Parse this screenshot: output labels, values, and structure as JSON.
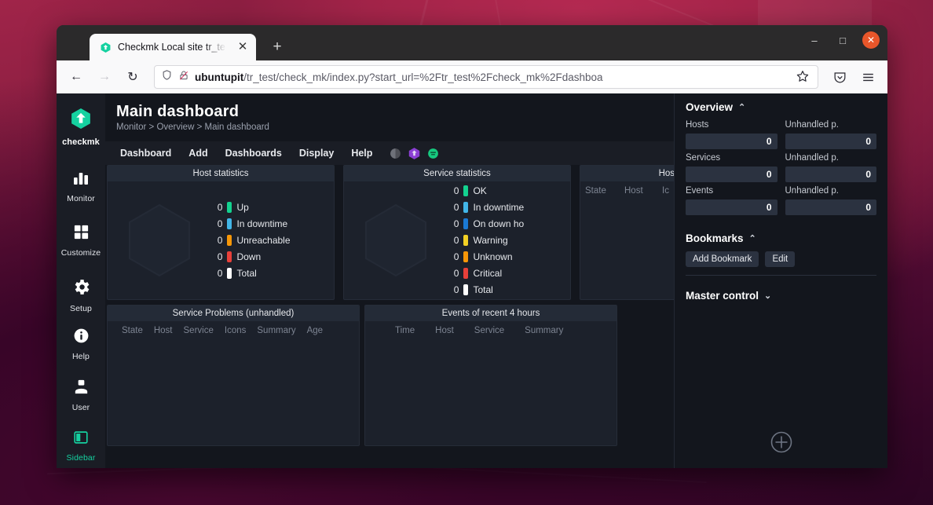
{
  "browser": {
    "tab": {
      "title": "Checkmk Local site tr_te",
      "favicon": "checkmk-hexagon-icon",
      "close": "✕"
    },
    "newtab_label": "+",
    "window_controls": {
      "minimize": "‒",
      "maximize": "□",
      "close": "✕"
    },
    "nav": {
      "back": "←",
      "forward": "→",
      "reload": "↻"
    },
    "url": {
      "host": "ubuntupit",
      "path": "/tr_test/check_mk/index.py?start_url=%2Ftr_test%2Fcheck_mk%2Fdashboa"
    },
    "toolbar_right": {
      "bookmark": "star-icon",
      "pocket": "pocket-icon",
      "menu": "hamburger-menu-icon"
    }
  },
  "sidebar_nav": {
    "brand": "checkmk",
    "items": [
      {
        "label": "Monitor",
        "icon": "bar-chart-icon"
      },
      {
        "label": "Customize",
        "icon": "grid-squares-icon"
      },
      {
        "label": "Setup",
        "icon": "gear-icon"
      }
    ],
    "bottom_items": [
      {
        "label": "Help",
        "icon": "info-circle-icon"
      },
      {
        "label": "User",
        "icon": "user-icon"
      },
      {
        "label": "Sidebar",
        "icon": "sidebar-toggle-icon"
      }
    ]
  },
  "page": {
    "title": "Main dashboard",
    "breadcrumb": "Monitor > Overview > Main dashboard",
    "menu": [
      "Dashboard",
      "Add",
      "Dashboards",
      "Display",
      "Help"
    ],
    "menu_icons": [
      "contrast-moon-icon",
      "checkmk-purple-hexagon-icon",
      "green-status-circle-icon"
    ]
  },
  "dashlets": {
    "host_statistics": {
      "title": "Host statistics",
      "rows": [
        {
          "count": "0",
          "label": "Up",
          "color": "#13d28f"
        },
        {
          "count": "0",
          "label": "In downtime",
          "color": "#42b6e8"
        },
        {
          "count": "0",
          "label": "Unreachable",
          "color": "#f79708"
        },
        {
          "count": "0",
          "label": "Down",
          "color": "#e8403a"
        },
        {
          "count": "0",
          "label": "Total",
          "color": "#ffffff"
        }
      ]
    },
    "service_statistics": {
      "title": "Service statistics",
      "rows": [
        {
          "count": "0",
          "label": "OK",
          "color": "#13d28f"
        },
        {
          "count": "0",
          "label": "In downtime",
          "color": "#42b6e8"
        },
        {
          "count": "0",
          "label": "On down ho",
          "color": "#1a79d4"
        },
        {
          "count": "0",
          "label": "Warning",
          "color": "#f2d024"
        },
        {
          "count": "0",
          "label": "Unknown",
          "color": "#f79708"
        },
        {
          "count": "0",
          "label": "Critical",
          "color": "#e8403a"
        },
        {
          "count": "0",
          "label": "Total",
          "color": "#ffffff"
        }
      ]
    },
    "host_problems": {
      "title": "Host Problems (u",
      "columns": [
        "State",
        "Host",
        "Ic"
      ]
    },
    "service_problems": {
      "title": "Service Problems (unhandled)",
      "columns": [
        "State",
        "Host",
        "Service",
        "Icons",
        "Summary",
        "Age"
      ]
    },
    "events": {
      "title": "Events of recent 4 hours",
      "columns": [
        "Time",
        "Host",
        "Service",
        "Summary"
      ]
    }
  },
  "right_panel": {
    "overview": {
      "title": "Overview",
      "chevron": "⌃",
      "rows": [
        {
          "label": "Hosts",
          "value": "0",
          "unhandled_label": "Unhandled p.",
          "unhandled_value": "0"
        },
        {
          "label": "Services",
          "value": "0",
          "unhandled_label": "Unhandled p.",
          "unhandled_value": "0"
        },
        {
          "label": "Events",
          "value": "0",
          "unhandled_label": "Unhandled p.",
          "unhandled_value": "0"
        }
      ]
    },
    "bookmarks": {
      "title": "Bookmarks",
      "chevron": "⌃",
      "add_label": "Add Bookmark",
      "edit_label": "Edit"
    },
    "master_control": {
      "title": "Master control",
      "chevron": "⌄"
    },
    "add_snapin": "add-snapin-button"
  }
}
